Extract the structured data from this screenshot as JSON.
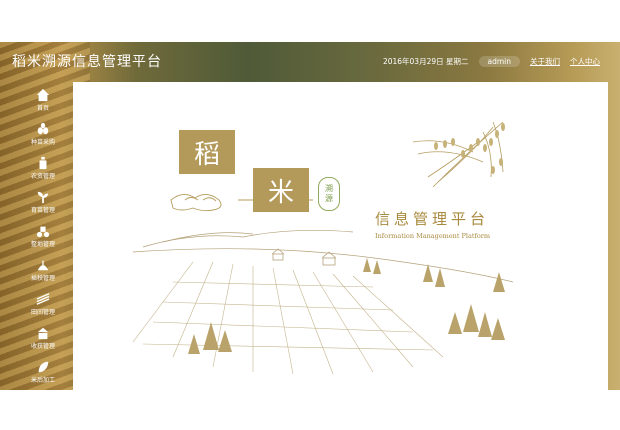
{
  "header": {
    "title": "稻米溯源信息管理平台",
    "date": "2016年03月29日 星期二",
    "user": "admin",
    "about": "关于我们",
    "profile": "个人中心"
  },
  "sidebar": {
    "items": [
      {
        "label": "首页",
        "icon": "home-icon"
      },
      {
        "label": "种苗采购",
        "icon": "seeds-icon"
      },
      {
        "label": "农资管理",
        "icon": "bottle-icon"
      },
      {
        "label": "育苗管理",
        "icon": "sprout-icon"
      },
      {
        "label": "整地管理",
        "icon": "tractor-icon"
      },
      {
        "label": "插秧管理",
        "icon": "planting-icon"
      },
      {
        "label": "田间管理",
        "icon": "field-icon"
      },
      {
        "label": "收获管理",
        "icon": "harvest-icon"
      },
      {
        "label": "米后加工",
        "icon": "processing-icon"
      }
    ]
  },
  "banner": {
    "char1": "稻",
    "char2": "米",
    "seal_top": "溯",
    "seal_bottom": "源",
    "title": "信息管理平台",
    "subtitle": "Information Management Platform"
  },
  "colors": {
    "accent": "#a88a3e",
    "char_box": "#b39a5a",
    "seal": "#7a9a48"
  }
}
